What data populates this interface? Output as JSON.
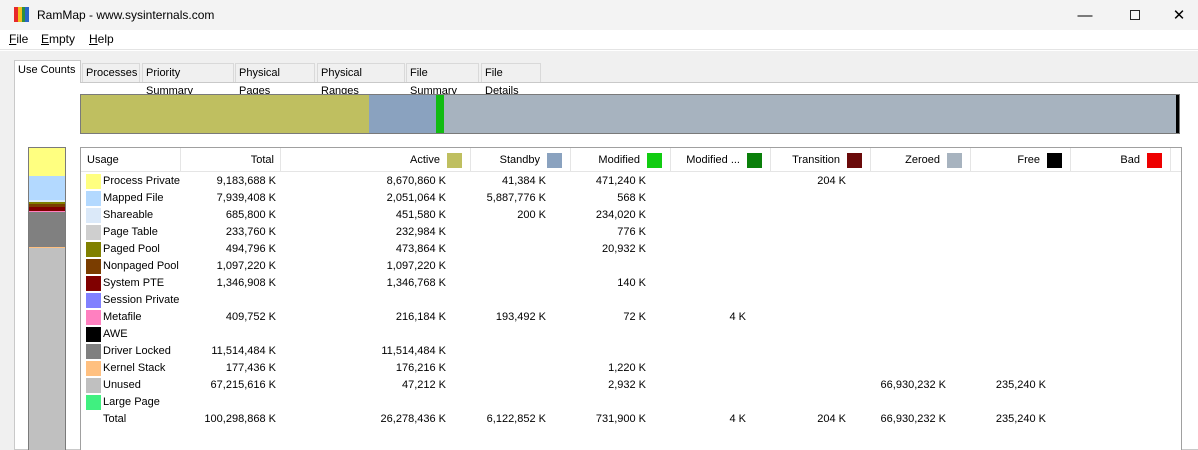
{
  "window": {
    "title": "RamMap - www.sysinternals.com",
    "icon_colors": [
      "#e8282a",
      "#f2c01c",
      "#2f8f3f",
      "#2a66c8"
    ]
  },
  "menu": [
    {
      "label": "File",
      "accel": "F",
      "rest": "ile"
    },
    {
      "label": "Empty",
      "accel": "E",
      "rest": "mpty"
    },
    {
      "label": "Help",
      "accel": "H",
      "rest": "elp"
    }
  ],
  "tabs": [
    "Use Counts",
    "Processes",
    "Priority Summary",
    "Physical Pages",
    "Physical Ranges",
    "File Summary",
    "File Details"
  ],
  "active_tab": "Use Counts",
  "overview_bar": [
    {
      "label": "Active",
      "color": "#bfbf60",
      "fraction": 0.262
    },
    {
      "label": "Standby",
      "color": "#8aa2bf",
      "fraction": 0.061
    },
    {
      "label": "Modified",
      "color": "#11bb11",
      "fraction": 0.0073
    },
    {
      "label": "Zeroed",
      "color": "#a7b3bf",
      "fraction": 0.667
    },
    {
      "label": "Free",
      "color": "#000000",
      "fraction": 0.0024
    }
  ],
  "columns": {
    "usage": "Usage",
    "total": "Total",
    "active": "Active",
    "standby": "Standby",
    "modified": "Modified",
    "modified_no_write": "Modified ...",
    "transition": "Transition",
    "zeroed": "Zeroed",
    "free": "Free",
    "bad": "Bad"
  },
  "column_colors": {
    "active": "#bfbf60",
    "standby": "#8aa2bf",
    "modified": "#11cc11",
    "modified_no_write": "#0a7f0a",
    "transition": "#6a0a0a",
    "zeroed": "#a7b3bf",
    "free": "#000000",
    "bad": "#ee0000"
  },
  "rows": [
    {
      "usage": "Process Private",
      "color": "#ffff80",
      "total": "9,183,688 K",
      "active": "8,670,860 K",
      "standby": "41,384 K",
      "modified": "471,240 K",
      "modified_no_write": "",
      "transition": "204 K",
      "zeroed": "",
      "free": "",
      "bad": ""
    },
    {
      "usage": "Mapped File",
      "color": "#b3d9ff",
      "total": "7,939,408 K",
      "active": "2,051,064 K",
      "standby": "5,887,776 K",
      "modified": "568 K",
      "modified_no_write": "",
      "transition": "",
      "zeroed": "",
      "free": "",
      "bad": ""
    },
    {
      "usage": "Shareable",
      "color": "#dbe9f9",
      "total": "685,800 K",
      "active": "451,580 K",
      "standby": "200 K",
      "modified": "234,020 K",
      "modified_no_write": "",
      "transition": "",
      "zeroed": "",
      "free": "",
      "bad": ""
    },
    {
      "usage": "Page Table",
      "color": "#cfcfcf",
      "total": "233,760 K",
      "active": "232,984 K",
      "standby": "",
      "modified": "776 K",
      "modified_no_write": "",
      "transition": "",
      "zeroed": "",
      "free": "",
      "bad": ""
    },
    {
      "usage": "Paged Pool",
      "color": "#808000",
      "total": "494,796 K",
      "active": "473,864 K",
      "standby": "",
      "modified": "20,932 K",
      "modified_no_write": "",
      "transition": "",
      "zeroed": "",
      "free": "",
      "bad": ""
    },
    {
      "usage": "Nonpaged Pool",
      "color": "#7a3d00",
      "total": "1,097,220 K",
      "active": "1,097,220 K",
      "standby": "",
      "modified": "",
      "modified_no_write": "",
      "transition": "",
      "zeroed": "",
      "free": "",
      "bad": ""
    },
    {
      "usage": "System PTE",
      "color": "#800000",
      "total": "1,346,908 K",
      "active": "1,346,768 K",
      "standby": "",
      "modified": "140 K",
      "modified_no_write": "",
      "transition": "",
      "zeroed": "",
      "free": "",
      "bad": ""
    },
    {
      "usage": "Session Private",
      "color": "#8080ff",
      "total": "",
      "active": "",
      "standby": "",
      "modified": "",
      "modified_no_write": "",
      "transition": "",
      "zeroed": "",
      "free": "",
      "bad": ""
    },
    {
      "usage": "Metafile",
      "color": "#ff80c0",
      "total": "409,752 K",
      "active": "216,184 K",
      "standby": "193,492 K",
      "modified": "72 K",
      "modified_no_write": "4 K",
      "transition": "",
      "zeroed": "",
      "free": "",
      "bad": ""
    },
    {
      "usage": "AWE",
      "color": "#000000",
      "total": "",
      "active": "",
      "standby": "",
      "modified": "",
      "modified_no_write": "",
      "transition": "",
      "zeroed": "",
      "free": "",
      "bad": ""
    },
    {
      "usage": "Driver Locked",
      "color": "#808080",
      "total": "11,514,484 K",
      "active": "11,514,484 K",
      "standby": "",
      "modified": "",
      "modified_no_write": "",
      "transition": "",
      "zeroed": "",
      "free": "",
      "bad": ""
    },
    {
      "usage": "Kernel Stack",
      "color": "#ffc080",
      "total": "177,436 K",
      "active": "176,216 K",
      "standby": "",
      "modified": "1,220 K",
      "modified_no_write": "",
      "transition": "",
      "zeroed": "",
      "free": "",
      "bad": ""
    },
    {
      "usage": "Unused",
      "color": "#c0c0c0",
      "total": "67,215,616 K",
      "active": "47,212 K",
      "standby": "",
      "modified": "2,932 K",
      "modified_no_write": "",
      "transition": "",
      "zeroed": "66,930,232 K",
      "free": "235,240 K",
      "bad": ""
    },
    {
      "usage": "Large Page",
      "color": "#40f080",
      "total": "",
      "active": "",
      "standby": "",
      "modified": "",
      "modified_no_write": "",
      "transition": "",
      "zeroed": "",
      "free": "",
      "bad": ""
    },
    {
      "usage": "Total",
      "color": "",
      "total": "100,298,868 K",
      "active": "26,278,436 K",
      "standby": "6,122,852 K",
      "modified": "731,900 K",
      "modified_no_write": "4 K",
      "transition": "204 K",
      "zeroed": "66,930,232 K",
      "free": "235,240 K",
      "bad": ""
    }
  ],
  "usage_bar": [
    {
      "label": "Process Private",
      "color": "#ffff80",
      "fraction": 0.0916
    },
    {
      "label": "Mapped File",
      "color": "#b3d9ff",
      "fraction": 0.0792
    },
    {
      "label": "Shareable",
      "color": "#dbe9f9",
      "fraction": 0.0068
    },
    {
      "label": "Page Table",
      "color": "#cfcfcf",
      "fraction": 0.0023
    },
    {
      "label": "Paged Pool",
      "color": "#808000",
      "fraction": 0.0049
    },
    {
      "label": "Nonpaged Pool",
      "color": "#7a3d00",
      "fraction": 0.0109
    },
    {
      "label": "System PTE",
      "color": "#800000",
      "fraction": 0.0134
    },
    {
      "label": "Metafile",
      "color": "#ff80c0",
      "fraction": 0.0041
    },
    {
      "label": "Driver Locked",
      "color": "#808080",
      "fraction": 0.1148
    },
    {
      "label": "Kernel Stack",
      "color": "#ffc080",
      "fraction": 0.0018
    },
    {
      "label": "Unused",
      "color": "#c0c0c0",
      "fraction": 0.6702
    }
  ]
}
